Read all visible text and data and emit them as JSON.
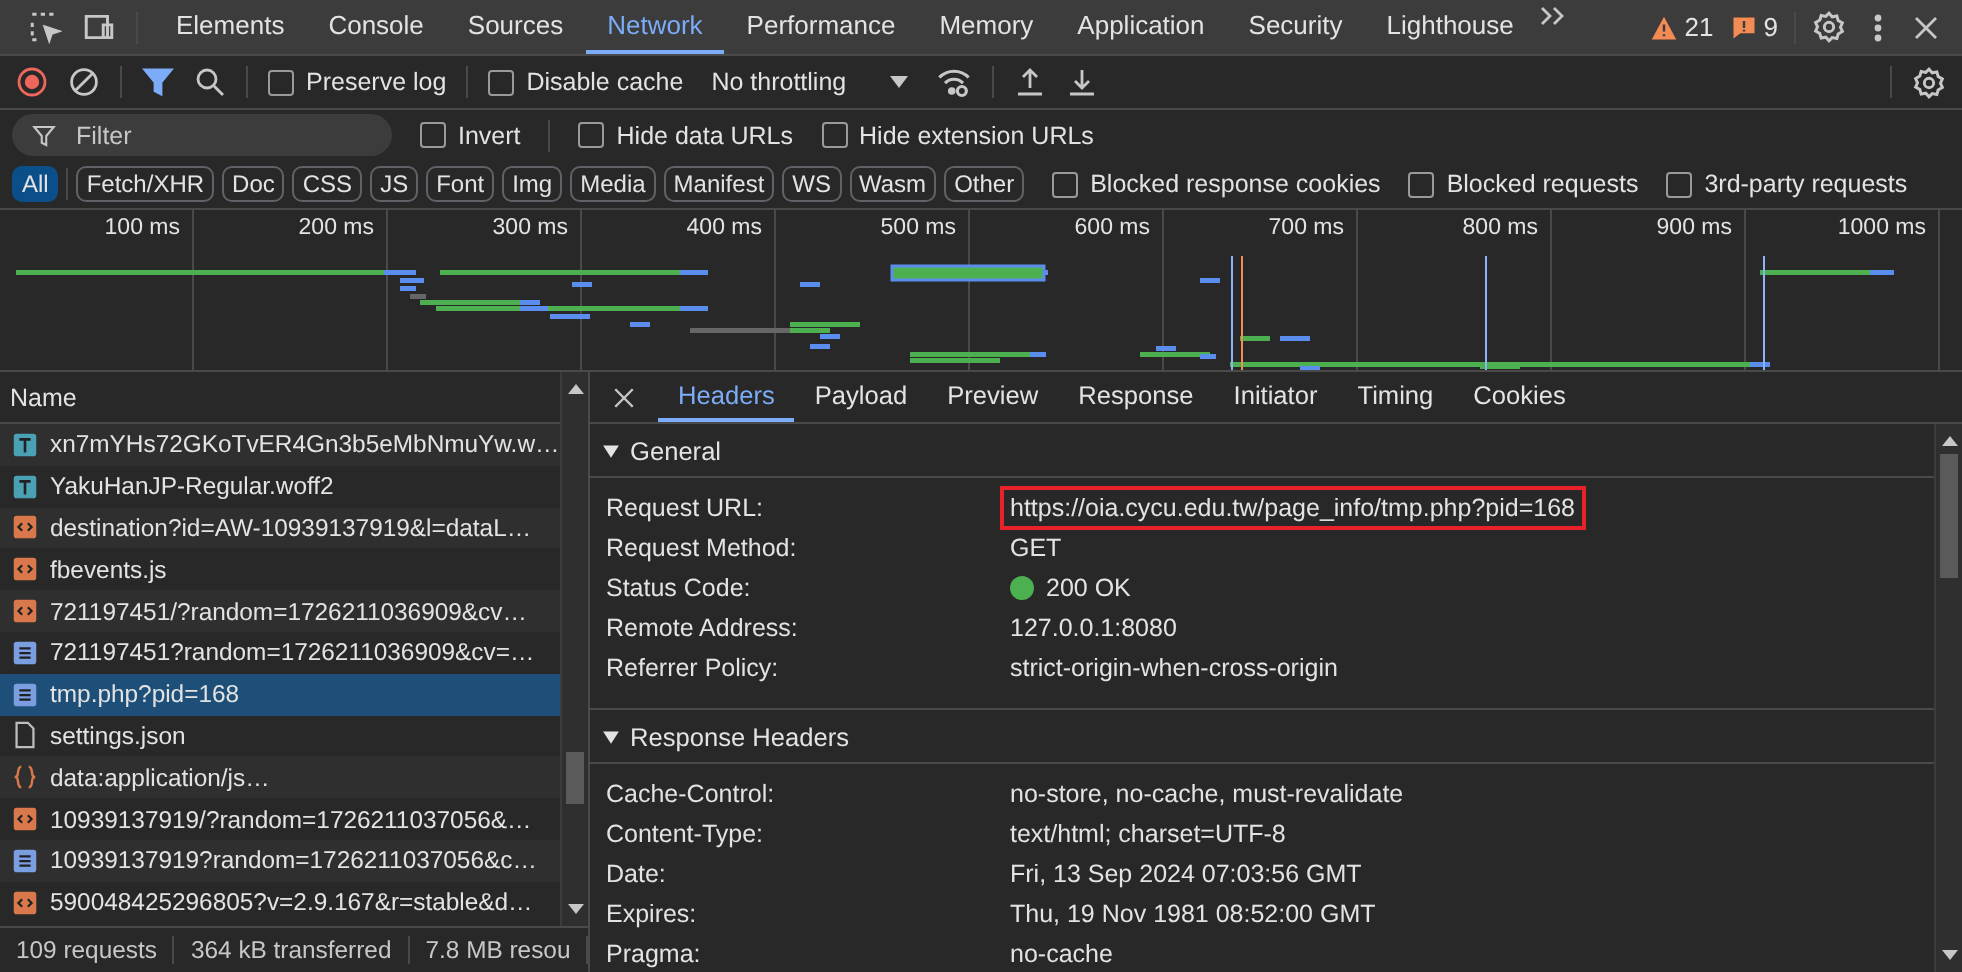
{
  "tabbar": {
    "tabs": [
      {
        "label": "Elements",
        "selected": false
      },
      {
        "label": "Console",
        "selected": false
      },
      {
        "label": "Sources",
        "selected": false
      },
      {
        "label": "Network",
        "selected": true
      },
      {
        "label": "Performance",
        "selected": false
      },
      {
        "label": "Memory",
        "selected": false
      },
      {
        "label": "Application",
        "selected": false
      },
      {
        "label": "Security",
        "selected": false
      },
      {
        "label": "Lighthouse",
        "selected": false
      }
    ],
    "warnings": "21",
    "issues": "9"
  },
  "toolbar": {
    "recording": true,
    "filter_on": true,
    "checks": [
      {
        "label": "Preserve log",
        "checked": false
      },
      {
        "label": "Disable cache",
        "checked": false
      }
    ],
    "throttling": "No throttling"
  },
  "filter": {
    "placeholder": "Filter",
    "checks": [
      {
        "label": "Invert",
        "checked": false
      },
      {
        "label": "Hide data URLs",
        "checked": false
      },
      {
        "label": "Hide extension URLs",
        "checked": false
      }
    ]
  },
  "types": [
    {
      "label": "All",
      "selected": true
    },
    {
      "label": "Fetch/XHR",
      "selected": false
    },
    {
      "label": "Doc",
      "selected": false
    },
    {
      "label": "CSS",
      "selected": false
    },
    {
      "label": "JS",
      "selected": false
    },
    {
      "label": "Font",
      "selected": false
    },
    {
      "label": "Img",
      "selected": false
    },
    {
      "label": "Media",
      "selected": false
    },
    {
      "label": "Manifest",
      "selected": false
    },
    {
      "label": "WS",
      "selected": false
    },
    {
      "label": "Wasm",
      "selected": false
    },
    {
      "label": "Other",
      "selected": false
    }
  ],
  "type_checks": [
    {
      "label": "Blocked response cookies",
      "checked": false
    },
    {
      "label": "Blocked requests",
      "checked": false
    },
    {
      "label": "3rd-party requests",
      "checked": false
    }
  ],
  "overview": {
    "ticks": [
      "100 ms",
      "200 ms",
      "300 ms",
      "400 ms",
      "500 ms",
      "600 ms",
      "700 ms",
      "800 ms",
      "900 ms",
      "1000 ms"
    ]
  },
  "requests": {
    "column": "Name",
    "rows": [
      {
        "name": "xn7mYHs72GKoTvER4Gn3b5eMbNmuYw.w…",
        "kind": "font",
        "selected": false
      },
      {
        "name": "YakuHanJP-Regular.woff2",
        "kind": "font",
        "selected": false
      },
      {
        "name": "destination?id=AW-10939137919&l=dataL…",
        "kind": "script",
        "selected": false
      },
      {
        "name": "fbevents.js",
        "kind": "script",
        "selected": false
      },
      {
        "name": "721197451/?random=1726211036909&cv…",
        "kind": "script",
        "selected": false
      },
      {
        "name": "721197451?random=1726211036909&cv=…",
        "kind": "document",
        "selected": false
      },
      {
        "name": "tmp.php?pid=168",
        "kind": "document",
        "selected": true
      },
      {
        "name": "settings.json",
        "kind": "file",
        "selected": false
      },
      {
        "name": "data:application/js…",
        "kind": "data",
        "selected": false
      },
      {
        "name": "10939137919/?random=1726211037056&…",
        "kind": "script",
        "selected": false
      },
      {
        "name": "10939137919?random=1726211037056&c…",
        "kind": "document",
        "selected": false
      },
      {
        "name": "590048425296805?v=2.9.167&r=stable&d…",
        "kind": "script",
        "selected": false
      }
    ]
  },
  "status_bar": [
    "109 requests",
    "364 kB transferred",
    "7.8 MB resou"
  ],
  "details": {
    "tabs": [
      {
        "label": "Headers",
        "selected": true
      },
      {
        "label": "Payload",
        "selected": false
      },
      {
        "label": "Preview",
        "selected": false
      },
      {
        "label": "Response",
        "selected": false
      },
      {
        "label": "Initiator",
        "selected": false
      },
      {
        "label": "Timing",
        "selected": false
      },
      {
        "label": "Cookies",
        "selected": false
      }
    ],
    "sections": [
      {
        "title": "General",
        "expanded": true,
        "rows": [
          {
            "key": "Request URL:",
            "value": "https://oia.cycu.edu.tw/page_info/tmp.php?pid=168",
            "highlighted": true,
            "kind": "text"
          },
          {
            "key": "Request Method:",
            "value": "GET",
            "highlighted": false,
            "kind": "text"
          },
          {
            "key": "Status Code:",
            "value": "200 OK",
            "highlighted": false,
            "kind": "status"
          },
          {
            "key": "Remote Address:",
            "value": "127.0.0.1:8080",
            "highlighted": false,
            "kind": "text"
          },
          {
            "key": "Referrer Policy:",
            "value": "strict-origin-when-cross-origin",
            "highlighted": false,
            "kind": "text"
          }
        ]
      },
      {
        "title": "Response Headers",
        "expanded": true,
        "rows": [
          {
            "key": "Cache-Control:",
            "value": "no-store, no-cache, must-revalidate",
            "highlighted": false,
            "kind": "text"
          },
          {
            "key": "Content-Type:",
            "value": "text/html; charset=UTF-8",
            "highlighted": false,
            "kind": "text"
          },
          {
            "key": "Date:",
            "value": "Fri, 13 Sep 2024 07:03:56 GMT",
            "highlighted": false,
            "kind": "text"
          },
          {
            "key": "Expires:",
            "value": "Thu, 19 Nov 1981 08:52:00 GMT",
            "highlighted": false,
            "kind": "text"
          },
          {
            "key": "Pragma:",
            "value": "no-cache",
            "highlighted": false,
            "kind": "text"
          }
        ]
      }
    ]
  }
}
